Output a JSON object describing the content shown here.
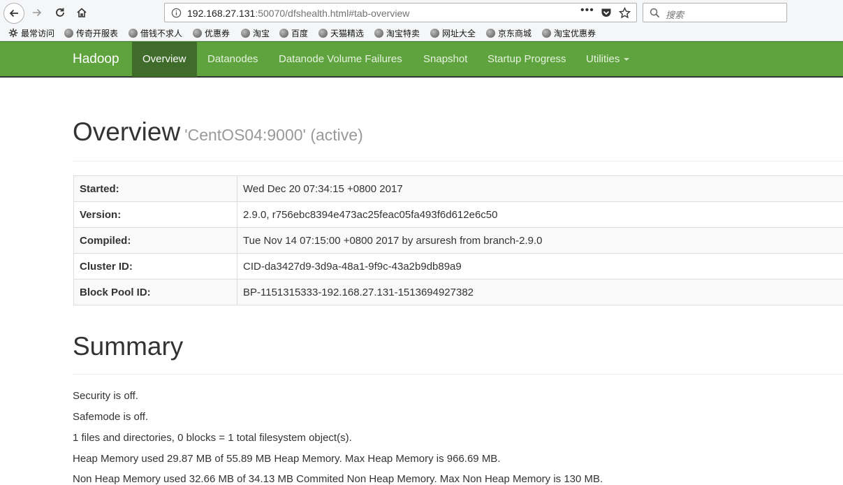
{
  "browser": {
    "url_host": "192.168.27.131",
    "url_path": ":50070/dfshealth.html#tab-overview",
    "search_placeholder": "搜索",
    "bookmarks": [
      "最常访问",
      "传奇开服表",
      "借钱不求人",
      "优惠券",
      "淘宝",
      "百度",
      "天猫精选",
      "淘宝特卖",
      "网址大全",
      "京东商城",
      "淘宝优惠券"
    ]
  },
  "navbar": {
    "brand": "Hadoop",
    "items": [
      "Overview",
      "Datanodes",
      "Datanode Volume Failures",
      "Snapshot",
      "Startup Progress",
      "Utilities"
    ],
    "active": "Overview"
  },
  "overview": {
    "title": "Overview",
    "subtitle": "'CentOS04:9000' (active)",
    "rows": [
      {
        "key": "Started:",
        "value": "Wed Dec 20 07:34:15 +0800 2017"
      },
      {
        "key": "Version:",
        "value": "2.9.0, r756ebc8394e473ac25feac05fa493f6d612e6c50"
      },
      {
        "key": "Compiled:",
        "value": "Tue Nov 14 07:15:00 +0800 2017 by arsuresh from branch-2.9.0"
      },
      {
        "key": "Cluster ID:",
        "value": "CID-da3427d9-3d9a-48a1-9f9c-43a2b9db89a9"
      },
      {
        "key": "Block Pool ID:",
        "value": "BP-1151315333-192.168.27.131-1513694927382"
      }
    ]
  },
  "summary": {
    "title": "Summary",
    "lines": [
      "Security is off.",
      "Safemode is off.",
      "1 files and directories, 0 blocks = 1 total filesystem object(s).",
      "Heap Memory used 29.87 MB of 55.89 MB Heap Memory. Max Heap Memory is 966.69 MB.",
      "Non Heap Memory used 32.66 MB of 34.13 MB Commited Non Heap Memory. Max Non Heap Memory is 130 MB."
    ]
  }
}
